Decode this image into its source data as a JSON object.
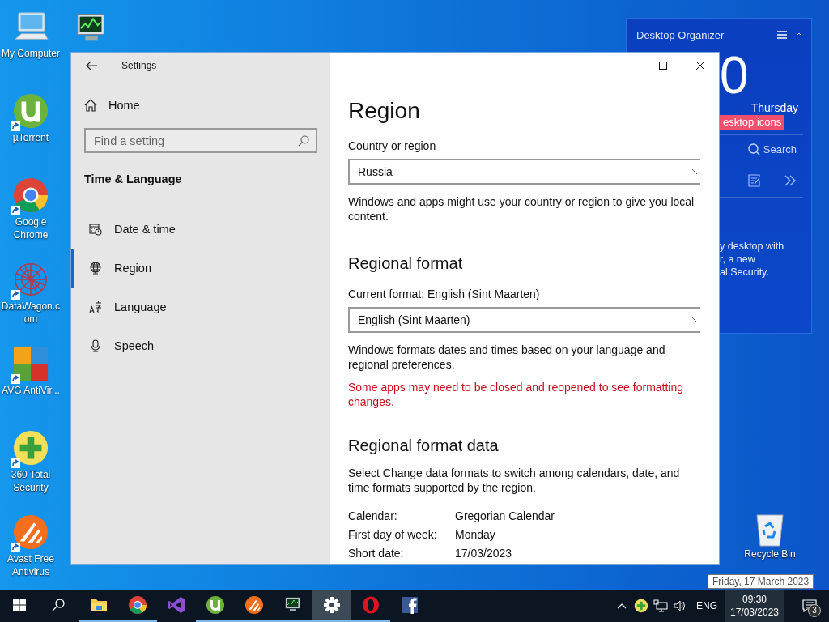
{
  "desktop_icons": [
    {
      "label": "My Computer",
      "kind": "computer",
      "shortcut": false
    },
    {
      "label": "µTorrent",
      "kind": "torrent",
      "shortcut": true
    },
    {
      "label": "Google Chrome",
      "kind": "chrome",
      "shortcut": true
    },
    {
      "label": "DataWagon.com",
      "kind": "mesh",
      "shortcut": true
    },
    {
      "label": "AVG AntiVir...",
      "kind": "tiles",
      "shortcut": true
    },
    {
      "label": "360 Total Security",
      "kind": "plus",
      "shortcut": true
    },
    {
      "label": "Avast Free Antivirus",
      "kind": "swoosh",
      "shortcut": true
    }
  ],
  "organizer": {
    "title": "Desktop Organizer",
    "clock_digit": "0",
    "day": "Thursday",
    "tag": "esktop icons",
    "search": "Search",
    "lines": [
      "y desktop with",
      "r, a new",
      "al Security."
    ]
  },
  "recycle_bin": {
    "label": "Recycle Bin"
  },
  "settings": {
    "title": "Settings",
    "home": "Home",
    "search": {
      "placeholder": "Find a setting"
    },
    "section": "Time & Language",
    "nav": [
      {
        "label": "Date & time",
        "kind": "date",
        "selected": false
      },
      {
        "label": "Region",
        "kind": "region",
        "selected": true
      },
      {
        "label": "Language",
        "kind": "language",
        "selected": false
      },
      {
        "label": "Speech",
        "kind": "speech",
        "selected": false
      }
    ],
    "page_title": "Region",
    "country_label": "Country or region",
    "country_value": "Russia",
    "country_note": "Windows and apps might use your country or region to give you local content.",
    "format_heading": "Regional format",
    "current_format": "Current format: English (Sint Maarten)",
    "format_value": "English (Sint Maarten)",
    "format_note": "Windows formats dates and times based on your language and regional preferences.",
    "warning": "Some apps may need to be closed and reopened to see formatting changes.",
    "data_heading": "Regional format data",
    "data_note": "Select Change data formats to switch among calendars, date, and time formats supported by the region.",
    "format_data": [
      {
        "label": "Calendar:",
        "value": "Gregorian Calendar"
      },
      {
        "label": "First day of week:",
        "value": "Monday"
      },
      {
        "label": "Short date:",
        "value": "17/03/2023"
      }
    ]
  },
  "taskbar": {
    "apps": [
      {
        "kind": "explorer",
        "running": true,
        "selected": false
      },
      {
        "kind": "chrome",
        "running": true,
        "selected": false
      },
      {
        "kind": "studio",
        "running": false,
        "selected": false
      },
      {
        "kind": "torrent",
        "running": true,
        "selected": false
      },
      {
        "kind": "swoosh",
        "running": true,
        "selected": false
      },
      {
        "kind": "monitor",
        "running": true,
        "selected": false
      },
      {
        "kind": "settings",
        "running": true,
        "selected": true
      },
      {
        "kind": "opera",
        "running": true,
        "selected": false
      },
      {
        "kind": "facebook",
        "running": false,
        "selected": false
      }
    ],
    "language": "ENG",
    "time": "09:30",
    "date": "17/03/2023",
    "notifications": "3"
  },
  "tooltip": "Friday, 17 March 2023"
}
